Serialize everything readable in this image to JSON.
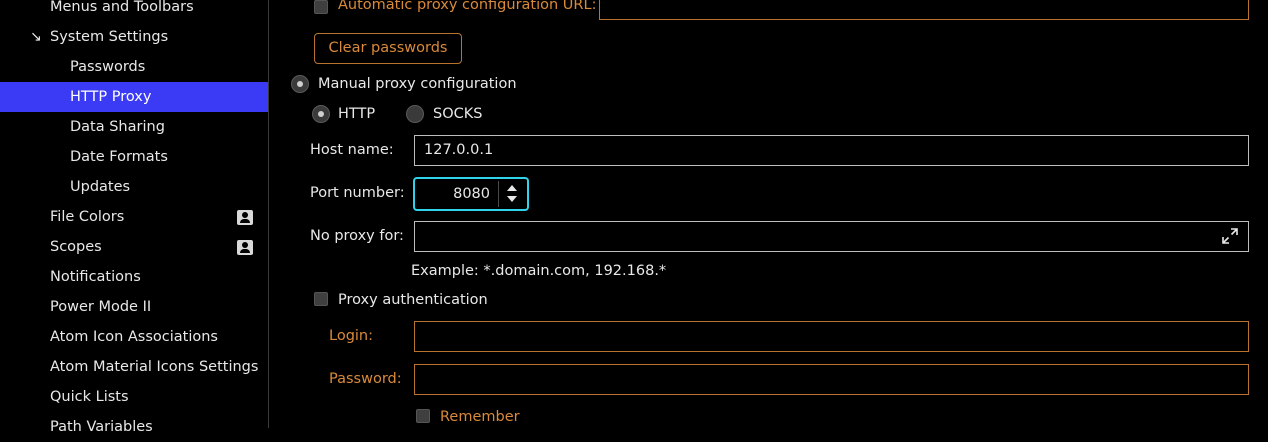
{
  "sidebar": {
    "items": [
      {
        "label": "Menus and Toolbars"
      },
      {
        "label": "System Settings",
        "expanded": true
      },
      {
        "label": "Passwords"
      },
      {
        "label": "HTTP Proxy",
        "selected": true
      },
      {
        "label": "Data Sharing"
      },
      {
        "label": "Date Formats"
      },
      {
        "label": "Updates"
      },
      {
        "label": "File Colors",
        "icon": "person-icon"
      },
      {
        "label": "Scopes",
        "icon": "person-icon"
      },
      {
        "label": "Notifications"
      },
      {
        "label": "Power Mode II"
      },
      {
        "label": "Atom Icon Associations"
      },
      {
        "label": "Atom Material Icons Settings"
      },
      {
        "label": "Quick Lists"
      },
      {
        "label": "Path Variables"
      }
    ],
    "expand_arrow": "↘"
  },
  "proxy": {
    "auto_config_label": "Automatic proxy configuration URL:",
    "auto_config_value": "",
    "clear_passwords_label": "Clear passwords",
    "manual_label": "Manual proxy configuration",
    "http_label": "HTTP",
    "socks_label": "SOCKS",
    "host_label": "Host name:",
    "host_value": "127.0.0.1",
    "port_label": "Port number:",
    "port_value": "8080",
    "no_proxy_label": "No proxy for:",
    "no_proxy_value": "",
    "example_text": "Example: *.domain.com, 192.168.*",
    "auth_label": "Proxy authentication",
    "login_label": "Login:",
    "login_value": "",
    "password_label": "Password:",
    "password_value": "",
    "remember_label": "Remember"
  },
  "colors": {
    "selected": "#3b3bf5",
    "accent_orange": "#d98a3a",
    "focus_cyan": "#2fd3ea"
  }
}
